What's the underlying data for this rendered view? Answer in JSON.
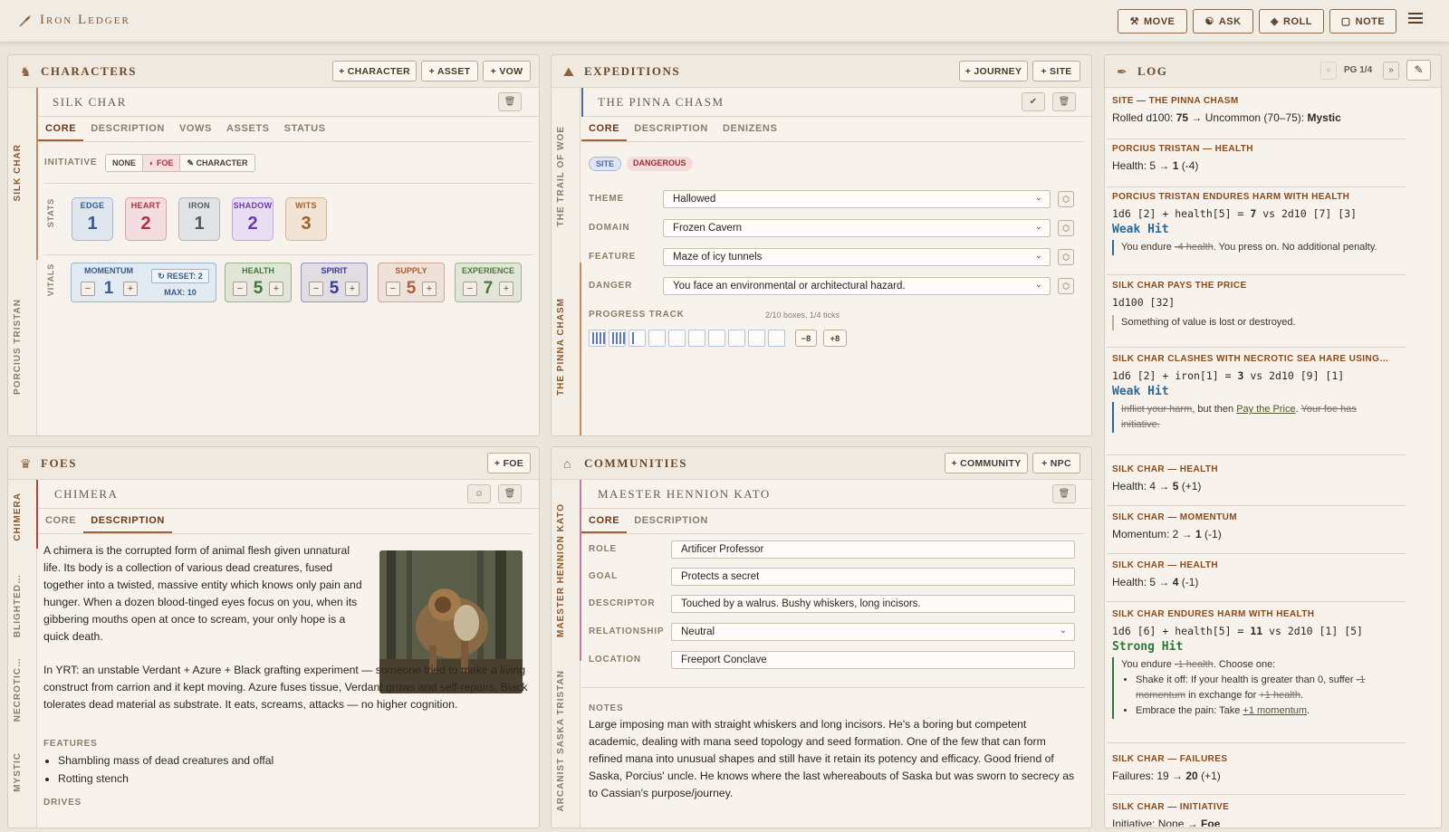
{
  "app": {
    "title": "Iron Ledger"
  },
  "topbar": {
    "move": "MOVE",
    "ask": "ASK",
    "roll": "ROLL",
    "note": "NOTE"
  },
  "characters": {
    "title": "CHARACTERS",
    "buttons": {
      "character": "+ CHARACTER",
      "asset": "+ ASSET",
      "vow": "+ VOW"
    },
    "rail": [
      "SILK CHAR",
      "PORCIUS TRISTAN"
    ],
    "active": "SILK CHAR",
    "tabs": [
      "CORE",
      "DESCRIPTION",
      "VOWS",
      "ASSETS",
      "STATUS"
    ],
    "initiative": {
      "label": "INITIATIVE",
      "options": [
        "NONE",
        "FOE",
        "CHARACTER"
      ],
      "selected": "FOE"
    },
    "stats_label": "STATS",
    "stats": [
      {
        "name": "EDGE",
        "value": "1",
        "color": "#3a5a9a",
        "bg": "#dfe6ee"
      },
      {
        "name": "HEART",
        "value": "2",
        "color": "#b03040",
        "bg": "#f3dde0"
      },
      {
        "name": "IRON",
        "value": "1",
        "color": "#555a60",
        "bg": "#e2e3e4"
      },
      {
        "name": "SHADOW",
        "value": "2",
        "color": "#6a3aa8",
        "bg": "#e8def3"
      },
      {
        "name": "WITS",
        "value": "3",
        "color": "#a0602a",
        "bg": "#f1e4d4"
      }
    ],
    "vitals_label": "VITALS",
    "momentum": {
      "name": "MOMENTUM",
      "value": "1",
      "reset": "RESET: 2",
      "max": "MAX: 10"
    },
    "vitals": [
      {
        "name": "HEALTH",
        "value": "5",
        "color": "#3a7a3a"
      },
      {
        "name": "SPIRIT",
        "value": "5",
        "color": "#3a3a9a"
      },
      {
        "name": "SUPPLY",
        "value": "5",
        "color": "#b05a3a"
      },
      {
        "name": "EXPERIENCE",
        "value": "7",
        "color": "#4a7a3a"
      }
    ]
  },
  "foes": {
    "title": "FOES",
    "add": "+ FOE",
    "rail": [
      "CHIMERA",
      "BLIGHTED…",
      "NECROTIC…",
      "MYSTIC"
    ],
    "active": "CHIMERA",
    "tabs": [
      "CORE",
      "DESCRIPTION"
    ],
    "p1": "A chimera is the corrupted form of animal flesh given unnatural life. Its body is a collection of various dead creatures, fused together into a twisted, massive entity which knows only pain and hunger. When a dozen blood-tinged eyes focus on you, when its gibbering mouths open at once to scream, your only hope is a quick death.",
    "p2": "In YRT: an unstable Verdant + Azure + Black grafting experiment — someone tried to make a living construct from carrion and it kept moving. Azure fuses tissue, Verdant grows and self-repairs, Black tolerates dead material as substrate. It eats, screams, attacks — no higher cognition.",
    "features_label": "FEATURES",
    "features": [
      "Shambling mass of dead creatures and offal",
      "Rotting stench"
    ],
    "drives_label": "DRIVES"
  },
  "expeditions": {
    "title": "EXPEDITIONS",
    "buttons": {
      "journey": "+ JOURNEY",
      "site": "+ SITE"
    },
    "rail": [
      "THE TRAIL OF WOE",
      "THE PINNA CHASM"
    ],
    "active": "THE PINNA CHASM",
    "tabs": [
      "CORE",
      "DESCRIPTION",
      "DENIZENS"
    ],
    "badges": [
      "SITE",
      "DANGEROUS"
    ],
    "rows": [
      {
        "label": "THEME",
        "value": "Hallowed"
      },
      {
        "label": "DOMAIN",
        "value": "Frozen Cavern"
      },
      {
        "label": "FEATURE",
        "value": "Maze of icy tunnels"
      },
      {
        "label": "DANGER",
        "value": "You face an environmental or architectural hazard."
      }
    ],
    "progress": {
      "label": "PROGRESS TRACK",
      "info": "2/10 boxes, 1/4 ticks",
      "boxes_filled": 2,
      "ticks": 1,
      "minus": "−8",
      "plus": "+8"
    }
  },
  "communities": {
    "title": "COMMUNITIES",
    "buttons": {
      "community": "+ COMMUNITY",
      "npc": "+ NPC"
    },
    "rail": [
      "MAESTER HENNION KATO",
      "ARCANIST SASKA TRISTAN"
    ],
    "active": "MAESTER HENNION KATO",
    "tabs": [
      "CORE",
      "DESCRIPTION"
    ],
    "rows": [
      {
        "label": "ROLE",
        "value": "Artificer Professor"
      },
      {
        "label": "GOAL",
        "value": "Protects a secret"
      },
      {
        "label": "DESCRIPTOR",
        "value": "Touched by a walrus. Bushy whiskers, long incisors."
      },
      {
        "label": "RELATIONSHIP",
        "value": "Neutral"
      },
      {
        "label": "LOCATION",
        "value": "Freeport Conclave"
      }
    ],
    "notes_label": "NOTES",
    "notes": "Large imposing man with straight whiskers and long incisors. He's a boring but competent academic, dealing with mana seed topology and seed formation. One of the few that can form refined mana into unusual shapes and still have it retain its potency and efficacy. Good friend of Saska, Porcius' uncle. He knows where the last whereabouts of Saska but was sworn to secrecy as to Cassian's purpose/journey."
  },
  "log": {
    "title": "LOG",
    "page": "PG 1/4",
    "entries": {
      "e1h": "SITE — THE PINNA CHASM",
      "e1a": "Rolled d100: ",
      "e1b": "75",
      "e1c": " → Uncommon (70–75): ",
      "e1d": "Mystic",
      "e2h": "PORCIUS TRISTAN — HEALTH",
      "e2a": "Health: 5 → ",
      "e2b": "1",
      "e2c": " (-4)",
      "e3h": "PORCIUS TRISTAN ENDURES HARM WITH HEALTH",
      "e3a": "1d6 [2] + health[5] = ",
      "e3b": "7",
      "e3c": " vs 2d10 [7] [3]",
      "e3hit": "Weak Hit",
      "e3q1": "You endure ",
      "e3q2": "-4 health",
      "e3q3": ". You press on. No additional penalty.",
      "e4h": "SILK CHAR PAYS THE PRICE",
      "e4a": "1d100 [32]",
      "e4q": "Something of value is lost or destroyed.",
      "e5h": "SILK CHAR CLASHES WITH NECROTIC SEA HARE USING…",
      "e5a": "1d6 [2] + iron[1] = ",
      "e5b": "3",
      "e5c": " vs 2d10 [9] [1]",
      "e5hit": "Weak Hit",
      "e5q1": "Inflict your harm",
      "e5q2": ", but then ",
      "e5q3": "Pay the Price",
      "e5q4": ". ",
      "e5q5": "Your foe has initiative.",
      "e6h": "SILK CHAR — HEALTH",
      "e6a": "Health: 4 → ",
      "e6b": "5",
      "e6c": " (+1)",
      "e7h": "SILK CHAR — MOMENTUM",
      "e7a": "Momentum: 2 → ",
      "e7b": "1",
      "e7c": " (-1)",
      "e8h": "SILK CHAR — HEALTH",
      "e8a": "Health: 5 → ",
      "e8b": "4",
      "e8c": " (-1)",
      "e9h": "SILK CHAR ENDURES HARM WITH HEALTH",
      "e9a": "1d6 [6] + health[5] = ",
      "e9b": "11",
      "e9c": " vs 2d10 [1] [5]",
      "e9hit": "Strong Hit",
      "e9q1": "You endure ",
      "e9q2": "-1 health",
      "e9q3": ". Choose one:",
      "e9l1a": "Shake it off: If your health is greater than 0, suffer ",
      "e9l1b": "-1 momentum",
      "e9l1c": " in exchange for ",
      "e9l1d": "+1 health",
      "e9l1e": ".",
      "e9l2a": "Embrace the pain: Take ",
      "e9l2b": "+1 momentum",
      "e9l2c": ".",
      "e10h": "SILK CHAR — FAILURES",
      "e10a": "Failures: 19 → ",
      "e10b": "20",
      "e10c": " (+1)",
      "e11h": "SILK CHAR — INITIATIVE",
      "e11a": "Initiative: None → ",
      "e11b": "Foe"
    }
  },
  "colors": {
    "accent": "#8a5a2a",
    "weak_hit": "#2a6a9a",
    "strong_hit": "#2a7a3a"
  }
}
